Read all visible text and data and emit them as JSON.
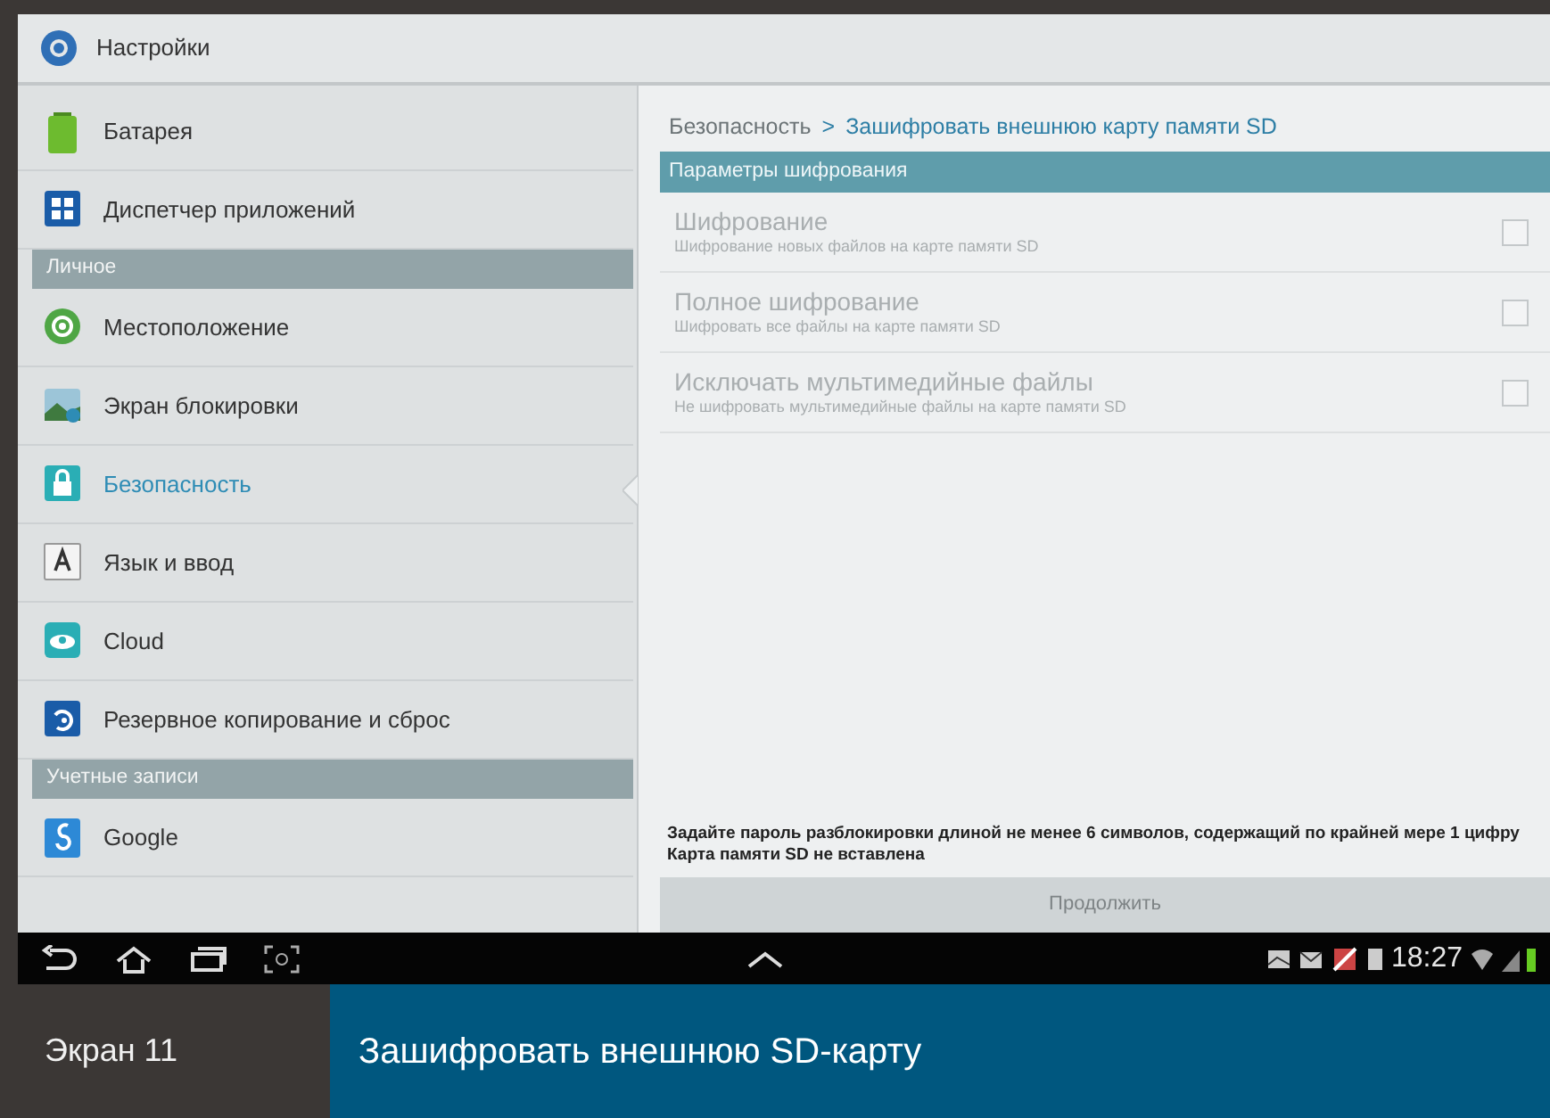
{
  "action_bar": {
    "title": "Настройки"
  },
  "sidebar": {
    "items": [
      {
        "kind": "item",
        "label": "Батарея",
        "selected": false
      },
      {
        "kind": "item",
        "label": "Диспетчер приложений",
        "selected": false
      },
      {
        "kind": "header",
        "label": "Личное"
      },
      {
        "kind": "item",
        "label": "Местоположение",
        "selected": false
      },
      {
        "kind": "item",
        "label": "Экран блокировки",
        "selected": false
      },
      {
        "kind": "item",
        "label": "Безопасность",
        "selected": true
      },
      {
        "kind": "item",
        "label": "Язык и ввод",
        "selected": false
      },
      {
        "kind": "item",
        "label": "Cloud",
        "selected": false
      },
      {
        "kind": "item",
        "label": "Резервное копирование и сброс",
        "selected": false
      },
      {
        "kind": "header",
        "label": "Учетные записи"
      },
      {
        "kind": "item",
        "label": "Google",
        "selected": false
      }
    ]
  },
  "breadcrumb": {
    "parent": "Безопасность",
    "separator": ">",
    "current": "Зашифровать внешнюю карту памяти SD"
  },
  "section_header": "Параметры шифрования",
  "options": [
    {
      "title": "Шифрование",
      "summary": "Шифрование новых файлов на карте памяти SD",
      "checked": false,
      "disabled": true
    },
    {
      "title": "Полное шифрование",
      "summary": "Шифровать все файлы на карте памяти SD",
      "checked": false,
      "disabled": true
    },
    {
      "title": "Исключать мультимедийные файлы",
      "summary": "Не шифровать мультимедийные файлы на карте памяти SD",
      "checked": false,
      "disabled": true
    }
  ],
  "notice": [
    "Задайте пароль разблокировки длиной не менее 6 символов, содержащий по крайней мере 1 цифру",
    "Карта памяти SD не вставлена"
  ],
  "continue_button": {
    "label": "Продолжить",
    "disabled": true
  },
  "status_bar": {
    "time": "18:27"
  },
  "caption": {
    "number": "Экран 11",
    "title": "Зашифровать внешнюю SD-карту"
  }
}
